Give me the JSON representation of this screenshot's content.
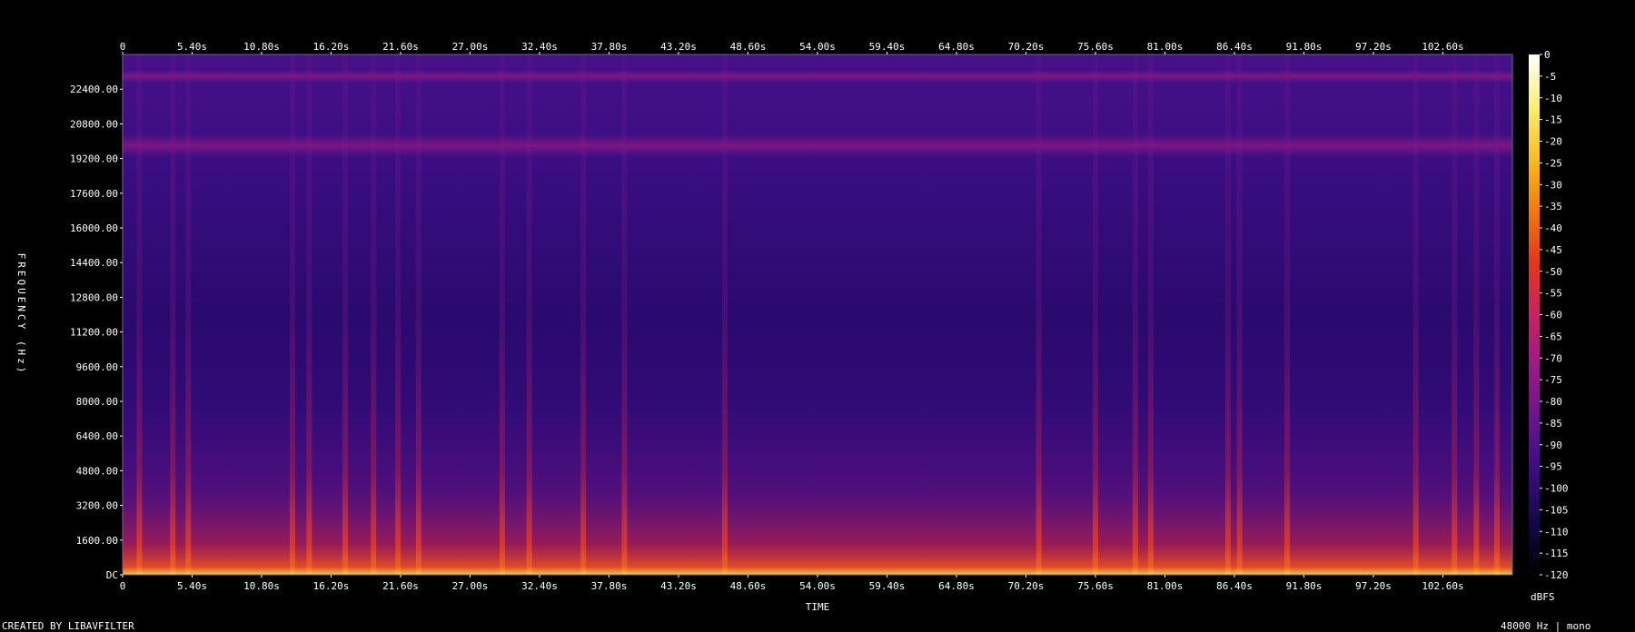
{
  "chart_data": {
    "type": "heatmap",
    "title": "",
    "xlabel": "TIME",
    "ylabel": "FREQUENCY (Hz)",
    "colorbar_label": "dBFS",
    "x_unit": "s",
    "x_range": [
      0,
      108.0
    ],
    "y_range": [
      0,
      24000
    ],
    "x_ticks": [
      "0",
      "5.40s",
      "10.80s",
      "16.20s",
      "21.60s",
      "27.00s",
      "32.40s",
      "37.80s",
      "43.20s",
      "48.60s",
      "54.00s",
      "59.40s",
      "64.80s",
      "70.20s",
      "75.60s",
      "81.00s",
      "86.40s",
      "91.80s",
      "97.20s",
      "102.60s"
    ],
    "y_ticks": [
      "DC",
      "1600.00",
      "3200.00",
      "4800.00",
      "6400.00",
      "8000.00",
      "9600.00",
      "11200.00",
      "12800.00",
      "14400.00",
      "16000.00",
      "17600.00",
      "19200.00",
      "20800.00",
      "22400.00"
    ],
    "colorbar_ticks": [
      "0",
      "-5",
      "-10",
      "-15",
      "-20",
      "-25",
      "-30",
      "-35",
      "-40",
      "-45",
      "-50",
      "-55",
      "-60",
      "-65",
      "-70",
      "-75",
      "-80",
      "-85",
      "-90",
      "-95",
      "-100",
      "-105",
      "-110",
      "-115",
      "-120"
    ],
    "colorbar_range": [
      -120,
      0
    ],
    "colormap": [
      "#000000",
      "#14064a",
      "#3a0c82",
      "#6a138e",
      "#9a1a86",
      "#cc2064",
      "#e8341c",
      "#f5780a",
      "#fbbd20",
      "#ffee70",
      "#ffffff"
    ],
    "energy_bursts_s": [
      1.3,
      3.9,
      5.1,
      13.2,
      14.5,
      17.3,
      19.5,
      21.4,
      23.0,
      29.5,
      31.6,
      35.8,
      39.0,
      46.8,
      71.2,
      75.6,
      78.7,
      79.9,
      85.9,
      86.8,
      90.5,
      100.5,
      103.5,
      105.2,
      106.8
    ],
    "persistent_bands_hz": [
      19800,
      23000
    ]
  },
  "footer": {
    "credit": "CREATED BY LIBAVFILTER",
    "sample_info": "48000 Hz | mono"
  }
}
